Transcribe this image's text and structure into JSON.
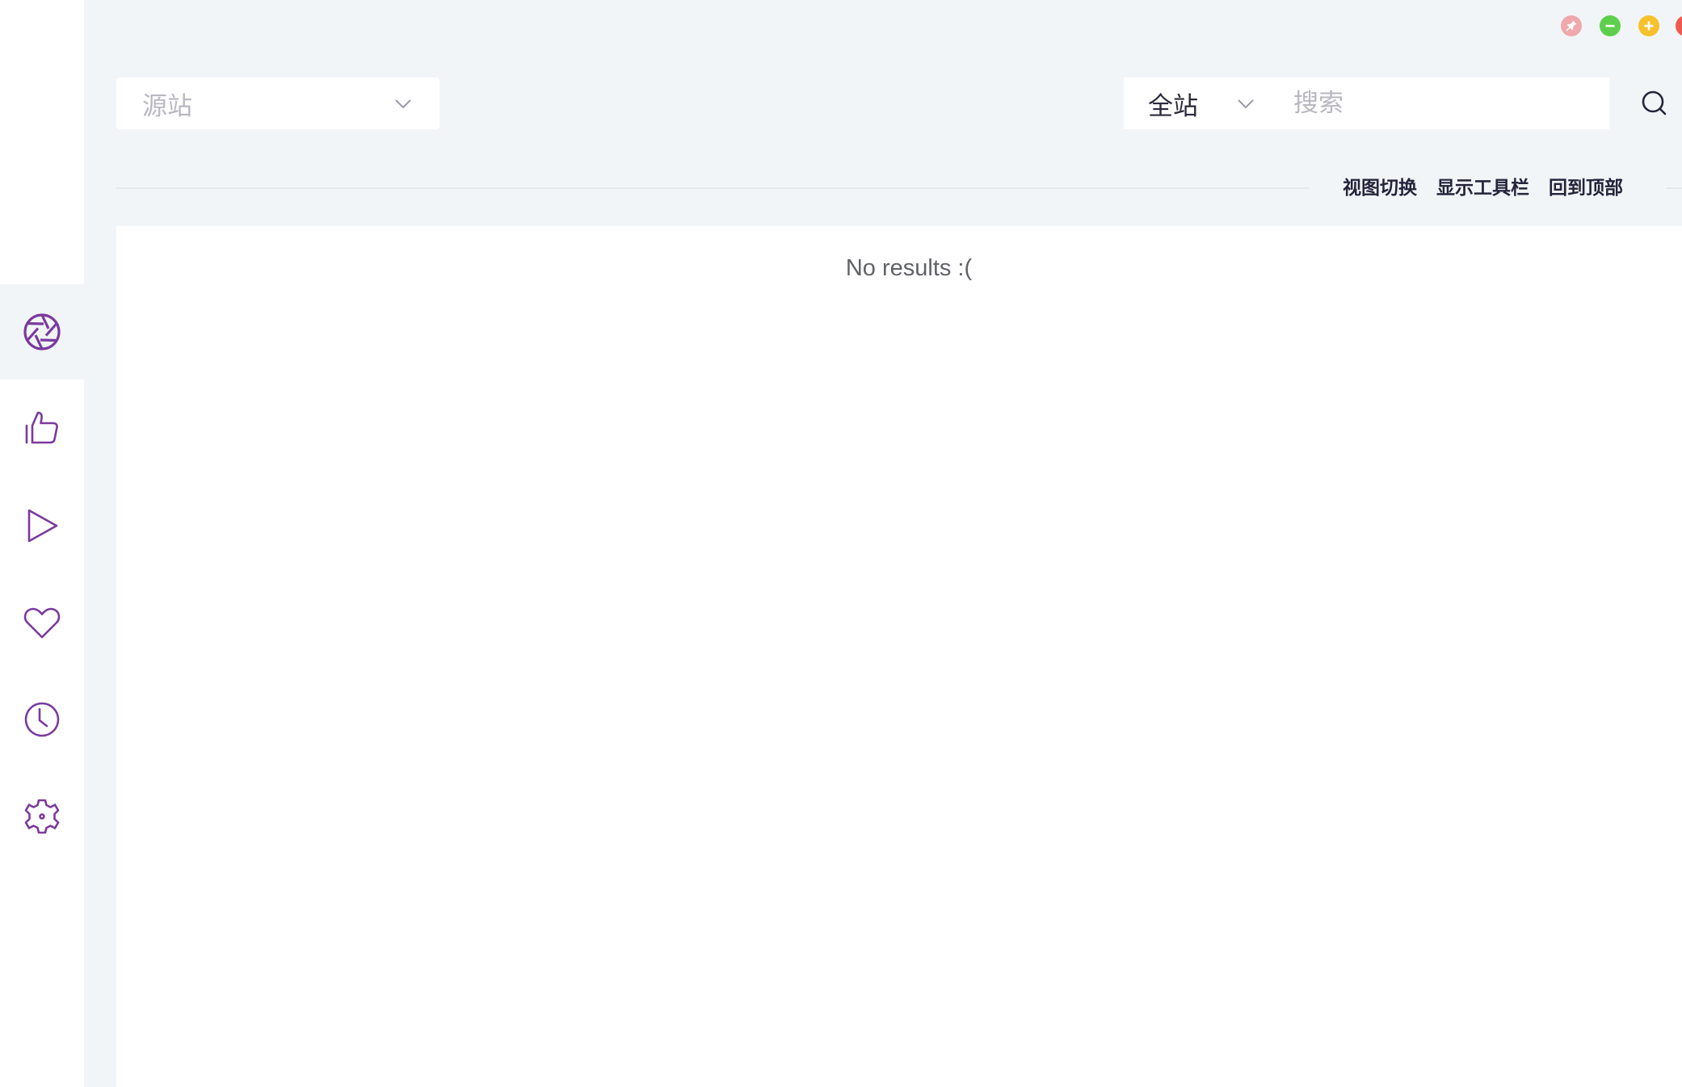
{
  "window_controls": [
    {
      "name": "pin",
      "color": "#f0a8ac"
    },
    {
      "name": "minimize",
      "color": "#5ecf4c"
    },
    {
      "name": "maximize",
      "color": "#f7c12c"
    },
    {
      "name": "close",
      "color": "#ee5a52"
    }
  ],
  "sidebar": {
    "accent_color": "#7b3a9e",
    "items": [
      {
        "name": "aperture-icon",
        "active": true
      },
      {
        "name": "thumbs-up-icon",
        "active": false
      },
      {
        "name": "play-icon",
        "active": false
      },
      {
        "name": "heart-icon",
        "active": false
      },
      {
        "name": "clock-icon",
        "active": false
      },
      {
        "name": "gear-icon",
        "active": false
      }
    ]
  },
  "source_select": {
    "placeholder": "源站"
  },
  "search": {
    "scope_value": "全站",
    "placeholder": "搜索",
    "value": ""
  },
  "toolbar": {
    "view_toggle": "视图切换",
    "show_toolbar": "显示工具栏",
    "back_to_top": "回到顶部"
  },
  "content": {
    "empty_message": "No results :("
  }
}
